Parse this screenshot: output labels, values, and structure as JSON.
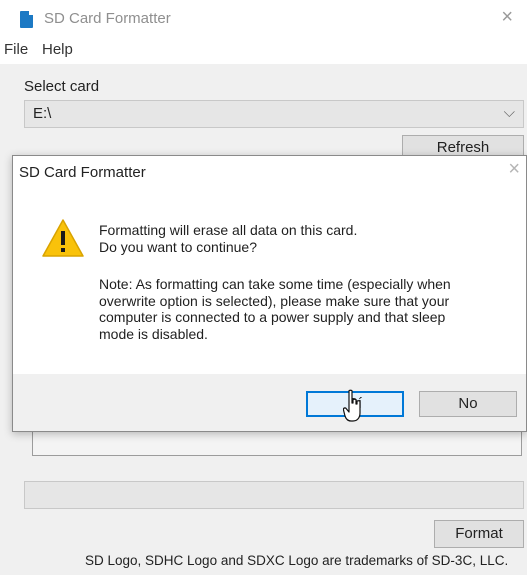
{
  "window": {
    "title": "SD Card Formatter",
    "close_glyph": "×",
    "icon": "sd-card-icon",
    "accent": "#1c79c4"
  },
  "menu": {
    "items": [
      "File",
      "Help"
    ]
  },
  "select_card": {
    "label": "Select card",
    "value": "E:\\",
    "chevron_glyph": "⌵",
    "refresh_label": "Refresh"
  },
  "footer": {
    "format_label": "Format",
    "trademark": "SD Logo, SDHC Logo and SDXC Logo are trademarks of SD-3C, LLC."
  },
  "dialog": {
    "title": "SD Card Formatter",
    "close_glyph": "×",
    "icon": "warning-icon",
    "message_line1": "Formatting will erase all data on this card.",
    "message_line2": "Do you want to continue?",
    "note": "Note: As formatting can take some time (especially when\noverwrite option is selected), please make sure that your\ncomputer is connected to a power supply and that sleep\nmode is disabled.",
    "yes_label": "Sí",
    "no_label": "No",
    "focus_color": "#0078d7"
  }
}
